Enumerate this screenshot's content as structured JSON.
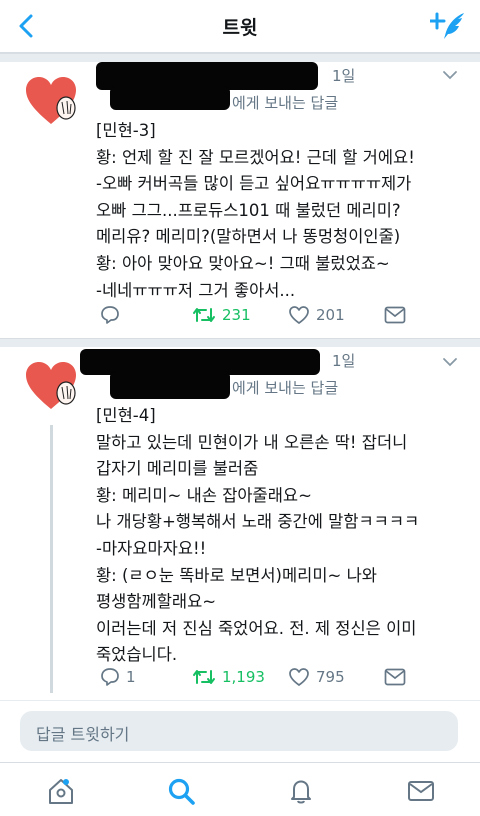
{
  "nav": {
    "title": "트윗"
  },
  "tweets": [
    {
      "time": "1일",
      "reply_to_suffix": "에게 보내는 답글",
      "lines": [
        "[민현-3]",
        "황: 언제 할 진 잘 모르겠어요! 근데 할 거에요!",
        "-오빠 커버곡들 많이 듣고 싶어요ㅠㅠㅠㅠ제가",
        "오빠 그그...프로듀스101 때 불렀던 메리미?",
        "메리유? 메리미?(말하면서 나 똥멍청이인줄)",
        "황: 아아 맞아요 맞아요~! 그때 불렀었죠~",
        "-네네ㅠㅠㅠ저 그거 좋아서..."
      ],
      "reply_count": "",
      "retweet_count": "231",
      "like_count": "201"
    },
    {
      "time": "1일",
      "reply_to_suffix": "에게 보내는 답글",
      "lines": [
        "[민현-4]",
        "말하고 있는데 민현이가 내 오른손 딱! 잡더니",
        "갑자기 메리미를 불러줌",
        "황: 메리미~ 내손 잡아줄래요~",
        "나 개당황+행복해서 노래 중간에 말함ㅋㅋㅋㅋ",
        "-마자요마자요!!",
        "황: (ㄹㅇ눈 똑바로 보면서)메리미~ 나와",
        "평생함께할래요~",
        "이러는데 저 진심 죽었어요. 전. 제 정신은 이미",
        "죽었습니다."
      ],
      "reply_count": "1",
      "retweet_count": "1,193",
      "like_count": "795"
    }
  ],
  "reply_bar": {
    "placeholder": "답글 트윗하기"
  },
  "tabbar": {
    "items": [
      "home-icon",
      "search-icon",
      "notifications-icon",
      "messages-icon"
    ]
  },
  "colors": {
    "accent": "#1da1f2",
    "retweet": "#17bf63",
    "muted": "#657786",
    "avatar_heart": "#e8584f"
  }
}
